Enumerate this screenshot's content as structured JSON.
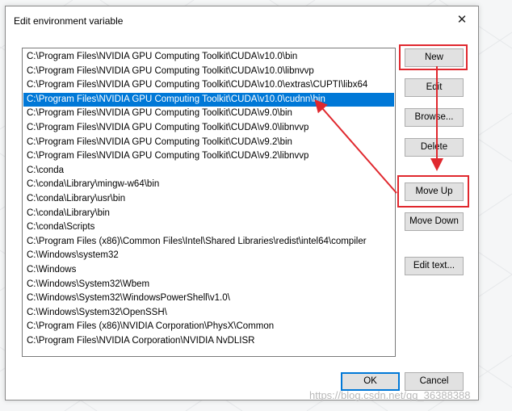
{
  "dialog": {
    "title": "Edit environment variable",
    "close_glyph": "✕"
  },
  "paths": [
    "C:\\Program Files\\NVIDIA GPU Computing Toolkit\\CUDA\\v10.0\\bin",
    "C:\\Program Files\\NVIDIA GPU Computing Toolkit\\CUDA\\v10.0\\libnvvp",
    "C:\\Program Files\\NVIDIA GPU Computing Toolkit\\CUDA\\v10.0\\extras\\CUPTI\\libx64",
    "C:\\Program Files\\NVIDIA GPU Computing Toolkit\\CUDA\\v10.0\\cudnn\\bin",
    "C:\\Program Files\\NVIDIA GPU Computing Toolkit\\CUDA\\v9.0\\bin",
    "C:\\Program Files\\NVIDIA GPU Computing Toolkit\\CUDA\\v9.0\\libnvvp",
    "C:\\Program Files\\NVIDIA GPU Computing Toolkit\\CUDA\\v9.2\\bin",
    "C:\\Program Files\\NVIDIA GPU Computing Toolkit\\CUDA\\v9.2\\libnvvp",
    "C:\\conda",
    "C:\\conda\\Library\\mingw-w64\\bin",
    "C:\\conda\\Library\\usr\\bin",
    "C:\\conda\\Library\\bin",
    "C:\\conda\\Scripts",
    "C:\\Program Files (x86)\\Common Files\\Intel\\Shared Libraries\\redist\\intel64\\compiler",
    "C:\\Windows\\system32",
    "C:\\Windows",
    "C:\\Windows\\System32\\Wbem",
    "C:\\Windows\\System32\\WindowsPowerShell\\v1.0\\",
    "C:\\Windows\\System32\\OpenSSH\\",
    "C:\\Program Files (x86)\\NVIDIA Corporation\\PhysX\\Common",
    "C:\\Program Files\\NVIDIA Corporation\\NVIDIA NvDLISR"
  ],
  "selected_index": 3,
  "buttons": {
    "new": "New",
    "edit": "Edit",
    "browse": "Browse...",
    "delete": "Delete",
    "move_up": "Move Up",
    "move_down": "Move Down",
    "edit_text": "Edit text...",
    "ok": "OK",
    "cancel": "Cancel"
  },
  "annotation_color": "#e0282e",
  "selection_color": "#0078d7",
  "watermark": "https://blog.csdn.net/qq_36388388"
}
